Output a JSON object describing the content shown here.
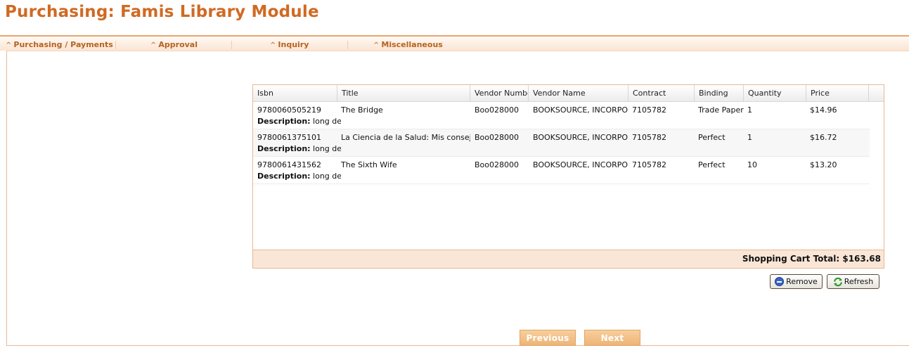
{
  "header": {
    "title": "Purchasing: Famis Library Module"
  },
  "menu": {
    "items": [
      {
        "label": "Purchasing / Payments"
      },
      {
        "label": "Approval"
      },
      {
        "label": "Inquiry"
      },
      {
        "label": "Miscellaneous"
      }
    ]
  },
  "grid": {
    "columns": [
      "Isbn",
      "Title",
      "Vendor Number",
      "Vendor Name",
      "Contract",
      "Binding",
      "Quantity",
      "Price"
    ],
    "description_label": "Description:",
    "rows": [
      {
        "isbn": "9780060505219",
        "title": "The Bridge",
        "vendor_number": "Boo028000",
        "vendor_name": "BOOKSOURCE, INCORPORA",
        "contract": "7105782",
        "binding": "Trade Paper",
        "quantity": "1",
        "price": "$14.96",
        "description": "long desc"
      },
      {
        "isbn": "9780061375101",
        "title": "La Ciencia de la Salud: Mis consejos p",
        "vendor_number": "Boo028000",
        "vendor_name": "BOOKSOURCE, INCORPORA",
        "contract": "7105782",
        "binding": "Perfect",
        "quantity": "1",
        "price": "$16.72",
        "description": "long desc"
      },
      {
        "isbn": "9780061431562",
        "title": "The Sixth Wife",
        "vendor_number": "Boo028000",
        "vendor_name": "BOOKSOURCE, INCORPORA",
        "contract": "7105782",
        "binding": "Perfect",
        "quantity": "10",
        "price": "$13.20",
        "description": "long desc"
      }
    ],
    "footer": {
      "total_text": "Shopping Cart Total: $163.68"
    }
  },
  "actions": {
    "remove_label": "Remove",
    "refresh_label": "Refresh"
  },
  "pager": {
    "previous_label": "Previous",
    "next_label": "Next"
  },
  "colors": {
    "brand": "#d06a23",
    "accent_bg": "#fae6d6",
    "nav_button": "#eeb476"
  }
}
